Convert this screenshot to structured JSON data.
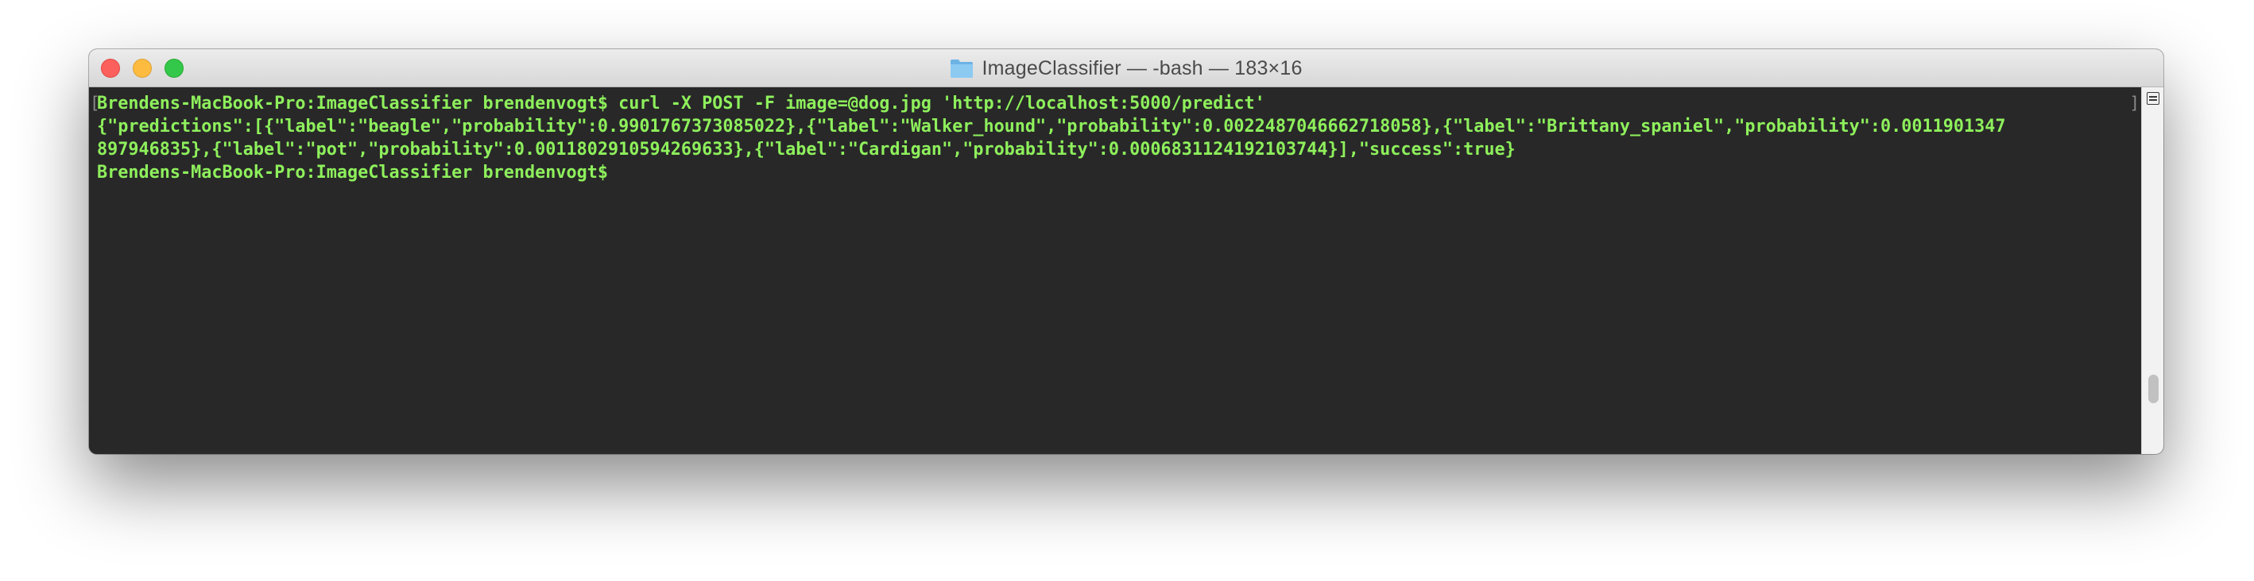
{
  "window": {
    "title": "ImageClassifier — -bash — 183×16",
    "title_icon": "folder-icon"
  },
  "terminal": {
    "lines": [
      "Brendens-MacBook-Pro:ImageClassifier brendenvogt$ curl -X POST -F image=@dog.jpg 'http://localhost:5000/predict'",
      "{\"predictions\":[{\"label\":\"beagle\",\"probability\":0.9901767373085022},{\"label\":\"Walker_hound\",\"probability\":0.0022487046662718058},{\"label\":\"Brittany_spaniel\",\"probability\":0.0011901347",
      "897946835},{\"label\":\"pot\",\"probability\":0.0011802910594269633},{\"label\":\"Cardigan\",\"probability\":0.0006831124192103744}],\"success\":true}",
      "Brendens-MacBook-Pro:ImageClassifier brendenvogt$"
    ],
    "bracket_left": "[",
    "bracket_right": "]",
    "text_color": "#8ef05c",
    "background_color": "#282828"
  },
  "colors": {
    "close": "#fc605c",
    "minimize": "#fdbc40",
    "maximize": "#34c84a"
  }
}
